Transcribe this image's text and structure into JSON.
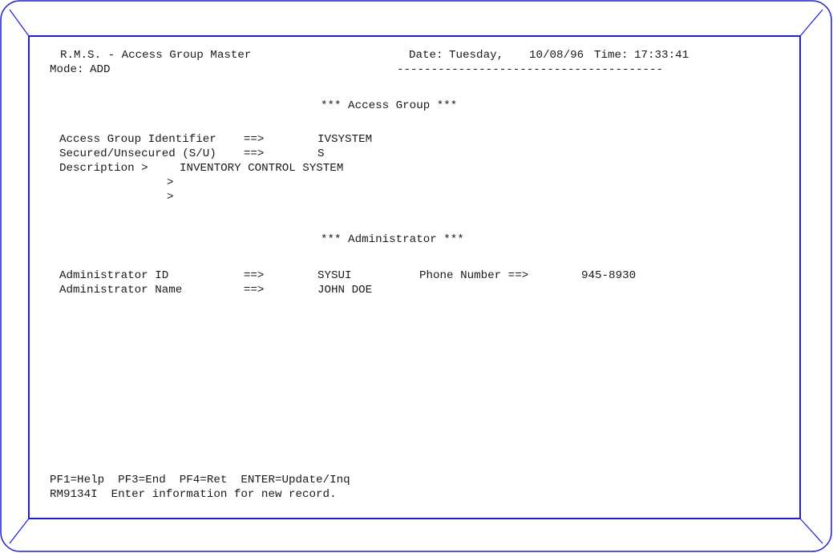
{
  "header": {
    "title": "R.M.S. - Access Group Master",
    "date_label": "Date:",
    "day": "Tuesday,",
    "date": "10/08/96",
    "time_label": "Time:",
    "time": "17:33:41",
    "mode_label": "Mode:",
    "mode": "ADD",
    "separator": "---------------------------------------"
  },
  "access_group": {
    "section_title": "*** Access Group ***",
    "identifier_label": "Access Group Identifier    ==>",
    "identifier_value": "IVSYSTEM",
    "secured_label": "Secured/Unsecured (S/U)    ==>",
    "secured_value": "S",
    "description_label": "Description >",
    "description_line1": "INVENTORY CONTROL SYSTEM",
    "description_prompt2": ">",
    "description_line2": "",
    "description_prompt3": ">",
    "description_line3": ""
  },
  "administrator": {
    "section_title": "*** Administrator ***",
    "id_label": "Administrator ID           ==>",
    "id_value": "SYSUI",
    "phone_label": "Phone Number ==>",
    "phone_value": "945-8930",
    "name_label": "Administrator Name         ==>",
    "name_value": "JOHN DOE"
  },
  "footer": {
    "pf_keys": "PF1=Help  PF3=End  PF4=Ret  ENTER=Update/Inq",
    "message": "RM9134I  Enter information for new record."
  },
  "colors": {
    "frame": "#1e1ed2",
    "text": "#1a1a1a",
    "background": "#ffffff"
  }
}
